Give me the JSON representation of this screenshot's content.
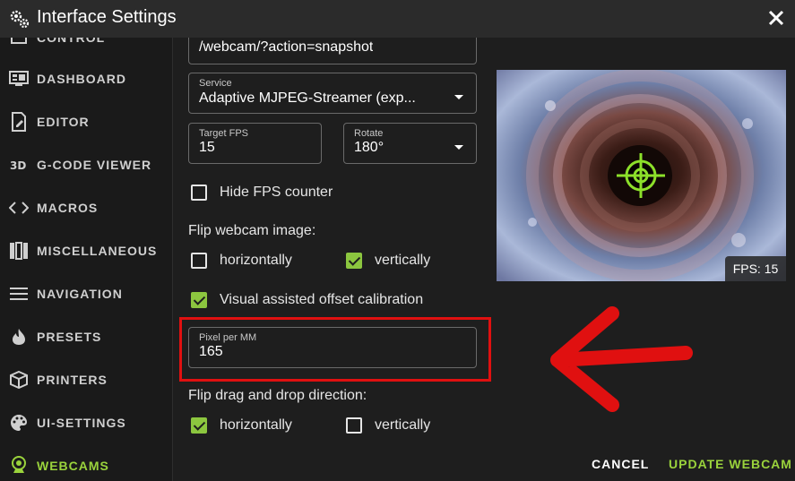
{
  "title": "Interface Settings",
  "sidebar": {
    "items": [
      {
        "label": "CONTROL",
        "icon": "control-icon"
      },
      {
        "label": "DASHBOARD",
        "icon": "dashboard-icon"
      },
      {
        "label": "EDITOR",
        "icon": "editor-icon"
      },
      {
        "label": "G-CODE VIEWER",
        "icon": "3d-icon"
      },
      {
        "label": "MACROS",
        "icon": "code-icon"
      },
      {
        "label": "MISCELLANEOUS",
        "icon": "miscellaneous-icon"
      },
      {
        "label": "NAVIGATION",
        "icon": "menu-icon"
      },
      {
        "label": "PRESETS",
        "icon": "fire-icon"
      },
      {
        "label": "PRINTERS",
        "icon": "printer-icon"
      },
      {
        "label": "UI-SETTINGS",
        "icon": "palette-icon"
      },
      {
        "label": "WEBCAMS",
        "icon": "webcam-icon",
        "active": true
      }
    ]
  },
  "form": {
    "url_value": "/webcam/?action=snapshot",
    "service": {
      "label": "Service",
      "value": "Adaptive MJPEG-Streamer (exp..."
    },
    "target_fps": {
      "label": "Target FPS",
      "value": "15"
    },
    "rotate": {
      "label": "Rotate",
      "value": "180°"
    },
    "hide_fps": {
      "label": "Hide FPS counter",
      "checked": false
    },
    "flip_image_label": "Flip webcam image:",
    "flip_h": {
      "label": "horizontally",
      "checked": false
    },
    "flip_v": {
      "label": "vertically",
      "checked": true
    },
    "visual_offset": {
      "label": "Visual assisted offset calibration",
      "checked": true
    },
    "pixel_per_mm": {
      "label": "Pixel per MM",
      "value": "165"
    },
    "flip_drag_label": "Flip drag and drop direction:",
    "drag_h": {
      "label": "horizontally",
      "checked": true
    },
    "drag_v": {
      "label": "vertically",
      "checked": false
    }
  },
  "preview": {
    "fps_badge": "FPS: 15"
  },
  "actions": {
    "cancel": "CANCEL",
    "update": "UPDATE WEBCAM"
  },
  "colors": {
    "accent": "#8cc63f",
    "highlight": "#e01010",
    "background": "#1e1e1e"
  }
}
